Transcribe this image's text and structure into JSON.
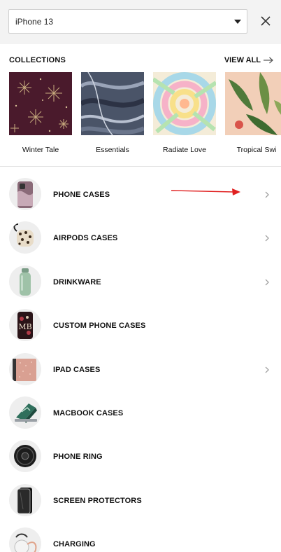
{
  "device_select": {
    "value": "iPhone 13"
  },
  "collections": {
    "title": "COLLECTIONS",
    "view_all": "VIEW ALL",
    "items": [
      {
        "label": "Winter Tale"
      },
      {
        "label": "Essentials"
      },
      {
        "label": "Radiate Love"
      },
      {
        "label": "Tropical Swi"
      }
    ]
  },
  "menu": {
    "items": [
      {
        "label": "PHONE CASES",
        "has_chevron": true
      },
      {
        "label": "AIRPODS CASES",
        "has_chevron": true
      },
      {
        "label": "DRINKWARE",
        "has_chevron": true
      },
      {
        "label": "CUSTOM PHONE CASES",
        "has_chevron": false
      },
      {
        "label": "IPAD CASES",
        "has_chevron": true
      },
      {
        "label": "MACBOOK CASES",
        "has_chevron": false
      },
      {
        "label": "PHONE RING",
        "has_chevron": false
      },
      {
        "label": "SCREEN PROTECTORS",
        "has_chevron": false
      },
      {
        "label": "CHARGING",
        "has_chevron": false
      }
    ]
  },
  "colors": {
    "annotation_arrow": "#e02020",
    "topbar_bg": "#f3f3f3"
  }
}
